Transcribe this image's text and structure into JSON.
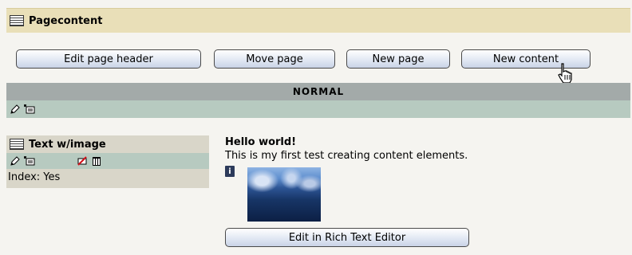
{
  "header": {
    "title": "Pagecontent"
  },
  "buttons": {
    "edit_page_header": "Edit page header",
    "move_page": "Move page",
    "new_page": "New page",
    "new_content": "New content"
  },
  "column": {
    "label": "NORMAL"
  },
  "content_element": {
    "type_label": "Text w/image",
    "index_text": "Index: Yes",
    "heading": "Hello world!",
    "body": "This is my first test creating content elements.",
    "edit_button": "Edit in Rich Text Editor"
  },
  "icons": {
    "page": "page-icon",
    "edit": "pencil-icon",
    "new": "new-content-icon",
    "hide": "hide-icon",
    "delete": "trash-icon",
    "info": "info-icon",
    "cursor": "hand-cursor-icon"
  },
  "colors": {
    "header_bar": "#e9dfb8",
    "column_bar": "#a3aaa9",
    "tools_bar": "#b7cac0",
    "ce_header": "#d9d6c9"
  }
}
